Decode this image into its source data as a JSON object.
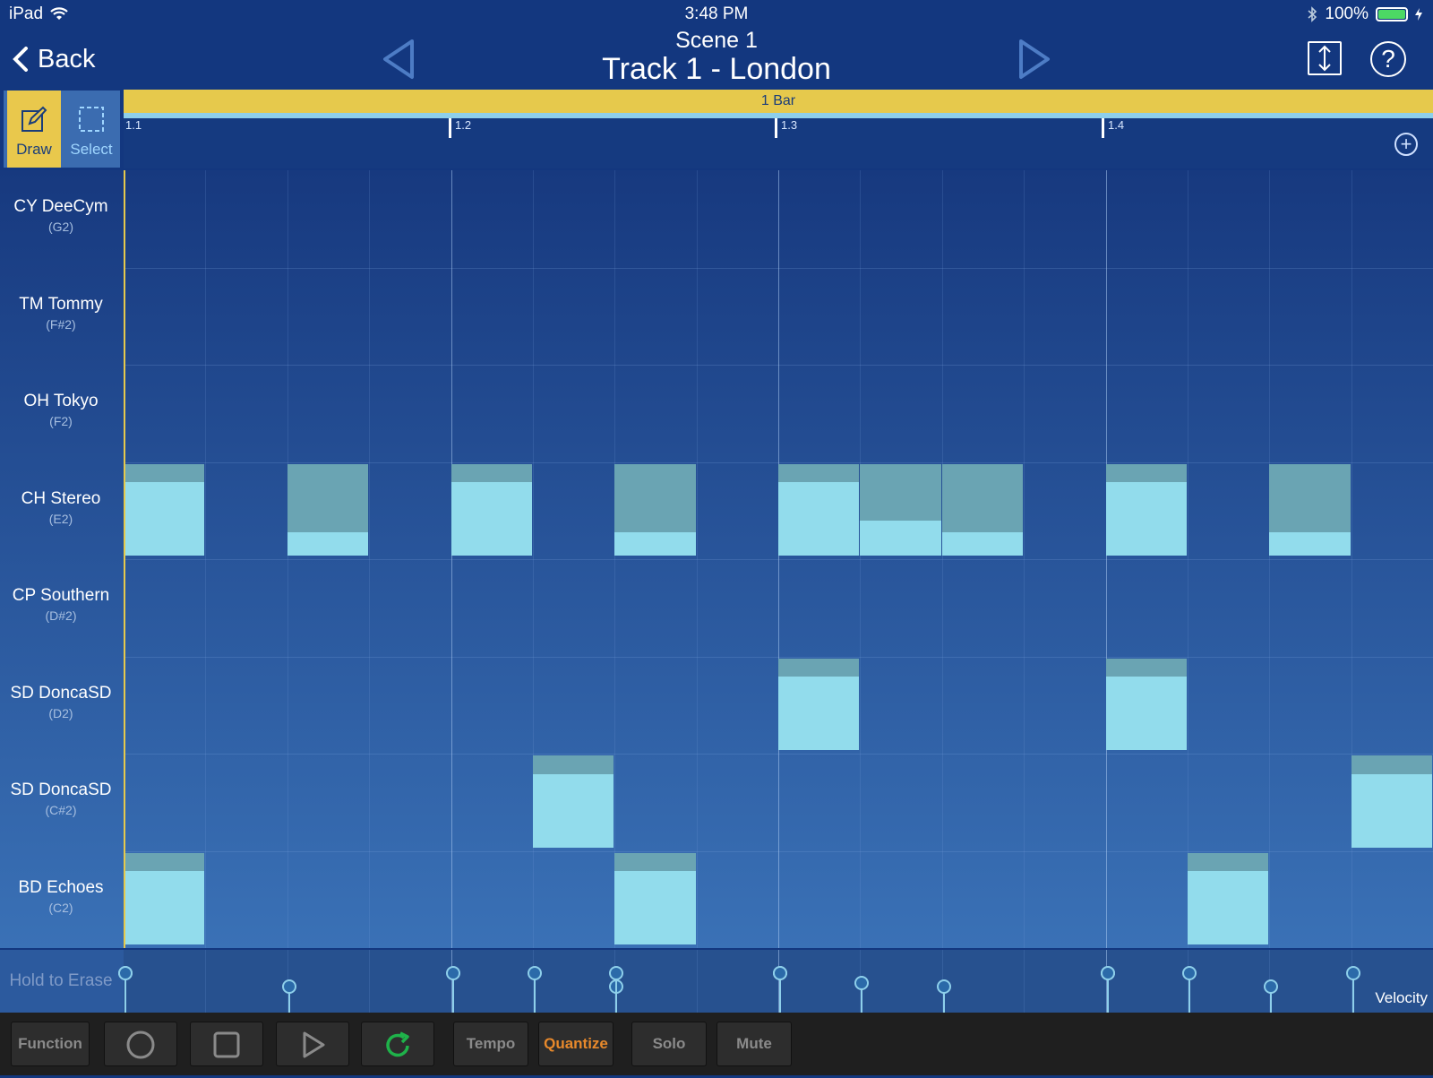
{
  "status": {
    "device": "iPad",
    "time": "3:48 PM",
    "battery": "100%"
  },
  "nav": {
    "back_label": "Back",
    "scene": "Scene  1",
    "track": "Track 1 - London"
  },
  "tools": {
    "draw": "Draw",
    "select": "Select"
  },
  "timeline": {
    "length_label": "1 Bar",
    "beats": [
      "1.1",
      "1.2",
      "1.3",
      "1.4"
    ],
    "steps": 16
  },
  "lanes": [
    {
      "name": "CY DeeCym",
      "key": "(G2)"
    },
    {
      "name": "TM Tommy",
      "key": "(F#2)"
    },
    {
      "name": "OH Tokyo",
      "key": "(F2)"
    },
    {
      "name": "CH Stereo",
      "key": "(E2)"
    },
    {
      "name": "CP Southern",
      "key": "(D#2)"
    },
    {
      "name": "SD DoncaSD",
      "key": "(D2)"
    },
    {
      "name": "SD DoncaSD",
      "key": "(C#2)"
    },
    {
      "name": "BD Echoes",
      "key": "(C2)"
    }
  ],
  "notes": [
    {
      "lane": 3,
      "step": 0,
      "velocity": 0.8
    },
    {
      "lane": 3,
      "step": 2,
      "velocity": 0.25
    },
    {
      "lane": 3,
      "step": 4,
      "velocity": 0.8
    },
    {
      "lane": 3,
      "step": 6,
      "velocity": 0.25
    },
    {
      "lane": 3,
      "step": 8,
      "velocity": 0.8
    },
    {
      "lane": 3,
      "step": 9,
      "velocity": 0.38
    },
    {
      "lane": 3,
      "step": 10,
      "velocity": 0.25
    },
    {
      "lane": 3,
      "step": 12,
      "velocity": 0.8
    },
    {
      "lane": 3,
      "step": 14,
      "velocity": 0.25
    },
    {
      "lane": 5,
      "step": 8,
      "velocity": 0.8
    },
    {
      "lane": 5,
      "step": 12,
      "velocity": 0.8
    },
    {
      "lane": 6,
      "step": 5,
      "velocity": 0.8
    },
    {
      "lane": 6,
      "step": 15,
      "velocity": 0.8
    },
    {
      "lane": 7,
      "step": 0,
      "velocity": 0.8
    },
    {
      "lane": 7,
      "step": 6,
      "velocity": 0.8
    },
    {
      "lane": 7,
      "step": 13,
      "velocity": 0.8
    }
  ],
  "velocity_lane": {
    "hint": "Hold to Erase",
    "label": "Velocity"
  },
  "toolbar": {
    "function": "Function",
    "tempo": "Tempo",
    "quantize": "Quantize",
    "solo": "Solo",
    "mute": "Mute"
  },
  "colors": {
    "accent": "#e9c84c",
    "note": "#92dcec",
    "note_dim": "#6aa4b3",
    "loop": "#1fb24a",
    "quantize": "#e8892b"
  },
  "icons": {
    "back": "chevron-left-icon",
    "prev": "triangle-left-icon",
    "next": "triangle-right-icon",
    "fit": "expand-vertical-icon",
    "help": "question-icon",
    "draw": "pencil-square-icon",
    "select": "dashed-rectangle-icon",
    "add": "plus-circle-icon",
    "record": "circle-icon",
    "stop": "square-icon",
    "play": "play-icon",
    "loop": "loop-icon"
  }
}
